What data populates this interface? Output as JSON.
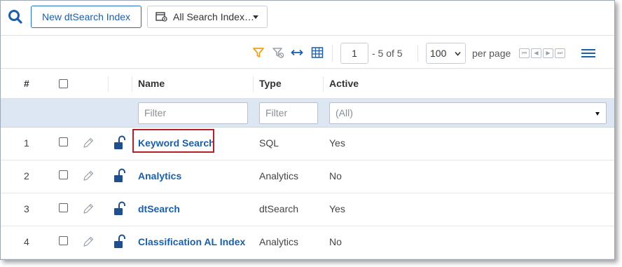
{
  "toolbar": {
    "search_icon": "search-icon",
    "new_index_label": "New dtSearch Index",
    "views_dropdown_label": "All Search Index…"
  },
  "pager": {
    "filter_icon": "filter-icon",
    "clear_filter_icon": "clear-filter-icon",
    "expand_icon": "expand-width-icon",
    "columns_icon": "grid-icon",
    "current_page": "1",
    "range_text": "- 5 of 5",
    "per_page_value": "100",
    "per_page_label": "per page",
    "nav_first": "⏮",
    "nav_prev": "◀",
    "nav_next": "▶",
    "nav_last": "⏭",
    "menu_icon": "hamburger-menu-icon"
  },
  "table": {
    "columns": {
      "number": "#",
      "name": "Name",
      "type": "Type",
      "active": "Active"
    },
    "filters": {
      "name": "Filter",
      "type": "Filter",
      "active": "(All)"
    },
    "rows": [
      {
        "num": "1",
        "name": "Keyword Search",
        "type": "SQL",
        "active": "Yes"
      },
      {
        "num": "2",
        "name": "Analytics",
        "type": "Analytics",
        "active": "No"
      },
      {
        "num": "3",
        "name": "dtSearch",
        "type": "dtSearch",
        "active": "Yes"
      },
      {
        "num": "4",
        "name": "Classification AL Index",
        "type": "Analytics",
        "active": "No"
      }
    ]
  },
  "colors": {
    "accent": "#1a5fa8",
    "filter_icon": "#f0a020",
    "filter_row_bg": "#dde6f3",
    "highlight": "#b2202a",
    "lock": "#1f4f8c"
  }
}
